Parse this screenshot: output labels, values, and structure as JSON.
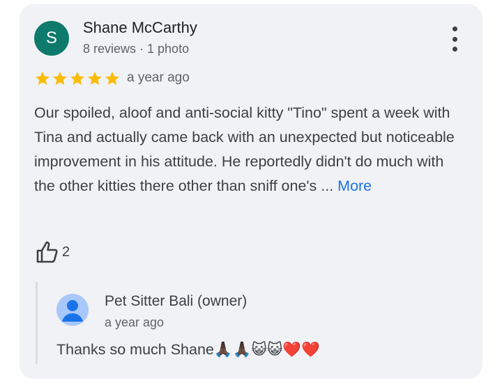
{
  "review": {
    "avatar_letter": "S",
    "avatar_color": "#0d7a6c",
    "reviewer_name": "Shane McCarthy",
    "reviewer_meta": "8 reviews · 1 photo",
    "rating": 5,
    "time": "a year ago",
    "text": "Our spoiled, aloof and anti-social kitty \"Tino\" spent a week with Tina and actually came back with an unexpected but noticeable improvement in his attitude. He reportedly didn't do much with the other kitties there other than sniff one's ... ",
    "more_label": "More",
    "like_count": "2"
  },
  "reply": {
    "owner_name": "Pet Sitter Bali (owner)",
    "time": "a year ago",
    "text": "Thanks so much Shane🙏🏿🙏🏿😺😺❤️❤️"
  },
  "colors": {
    "card_bg": "#f1f2f6",
    "star": "#fbbc04",
    "link": "#1a73e8",
    "owner_avatar": "#a8c7fa"
  },
  "icons": {
    "menu": "more-vert-icon",
    "star": "star-icon",
    "like": "thumb-up-icon",
    "owner_avatar": "person-icon"
  }
}
